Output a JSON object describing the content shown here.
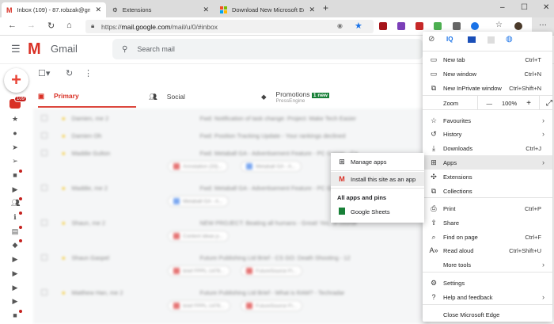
{
  "browser": {
    "tabs": [
      {
        "title": "Inbox (109) - 87.robzak@gmail.c",
        "icon": "gmail-icon"
      },
      {
        "title": "Extensions",
        "icon": "extensions-icon"
      },
      {
        "title": "Download New Microsoft Edge",
        "icon": "microsoft-icon"
      }
    ],
    "new_tab": "+",
    "window": {
      "minimize": "–",
      "maximize": "☐",
      "close": "✕"
    },
    "url_prefix": "https://",
    "url_host": "mail.google.com",
    "url_path": "/mail/u/0/#inbox",
    "more": "···"
  },
  "gmail": {
    "brand": "Gmail",
    "search_placeholder": "Search mail",
    "badge": "109",
    "categories": [
      {
        "label": "Primary"
      },
      {
        "label": "Social"
      },
      {
        "label": "Promotions",
        "badge": "1 new",
        "sub": "PressEngine"
      }
    ],
    "emails": [
      {
        "sender": "Damien, me 2",
        "subject": "Fwd: Notification of task change: Project: Make Tech Easier"
      },
      {
        "sender": "Damien Oh",
        "subject": "Fwd: Position Tracking Update - Your rankings declined"
      },
      {
        "sender": "Maddie Gulton",
        "subject": "Fwd: Metaball GA - Advertisement Feature - PC Gamer - Ca",
        "chips": [
          "Annotation (33)...",
          "Metaball GA - A..."
        ]
      },
      {
        "sender": "Maddie, me 2",
        "subject": "Fwd: Metaball GA - Advertisement Feature - PC Gamer - Ca",
        "chips": [
          "Metaball GA - A..."
        ]
      },
      {
        "sender": "Shaun, me 2",
        "subject": "NEW PROJECT: Beating all humans - Great! Yes, of course",
        "chips": [
          "Content ideas p..."
        ]
      },
      {
        "sender": "Shaun Gaspel",
        "subject": "Future Publishing Ltd Brief - CS GO: Death Shooting - 12",
        "chips": [
          "brief FPPL-1476...",
          "FutureSource Fi..."
        ]
      },
      {
        "sender": "Matthew Han, me 2",
        "subject": "Future Publishing Ltd Brief - What is RAM? - Techradar",
        "chips": [
          "brief FPPL-1476...",
          "FutureSource Fi..."
        ]
      }
    ]
  },
  "edge_menu": {
    "items": [
      {
        "label": "New tab",
        "shortcut": "Ctrl+T",
        "icon": "new-tab-icon"
      },
      {
        "label": "New window",
        "shortcut": "Ctrl+N",
        "icon": "new-window-icon"
      },
      {
        "label": "New InPrivate window",
        "shortcut": "Ctrl+Shift+N",
        "icon": "inprivate-icon"
      },
      {
        "label": "Favourites",
        "icon": "favourites-icon"
      },
      {
        "label": "History",
        "icon": "history-icon"
      },
      {
        "label": "Downloads",
        "shortcut": "Ctrl+J",
        "icon": "download-icon"
      },
      {
        "label": "Apps",
        "icon": "apps-icon"
      },
      {
        "label": "Extensions",
        "icon": "extensions-icon"
      },
      {
        "label": "Collections",
        "icon": "collections-icon"
      },
      {
        "label": "Print",
        "shortcut": "Ctrl+P",
        "icon": "print-icon"
      },
      {
        "label": "Share",
        "icon": "share-icon"
      },
      {
        "label": "Find on page",
        "shortcut": "Ctrl+F",
        "icon": "find-icon"
      },
      {
        "label": "Read aloud",
        "shortcut": "Ctrl+Shift+U",
        "icon": "read-aloud-icon"
      },
      {
        "label": "More tools"
      },
      {
        "label": "Settings",
        "icon": "settings-icon"
      },
      {
        "label": "Help and feedback",
        "icon": "help-icon"
      },
      {
        "label": "Close Microsoft Edge"
      }
    ],
    "zoom": {
      "label": "Zoom",
      "minus": "—",
      "value": "100%",
      "plus": "+"
    }
  },
  "apps_submenu": {
    "manage": "Manage apps",
    "install": "Install this site as an app",
    "section": "All apps and pins",
    "sheets": "Google Sheets"
  },
  "colors": {
    "gmail_red": "#d93025",
    "sheets_green": "#188038",
    "new_badge": "#188038"
  }
}
